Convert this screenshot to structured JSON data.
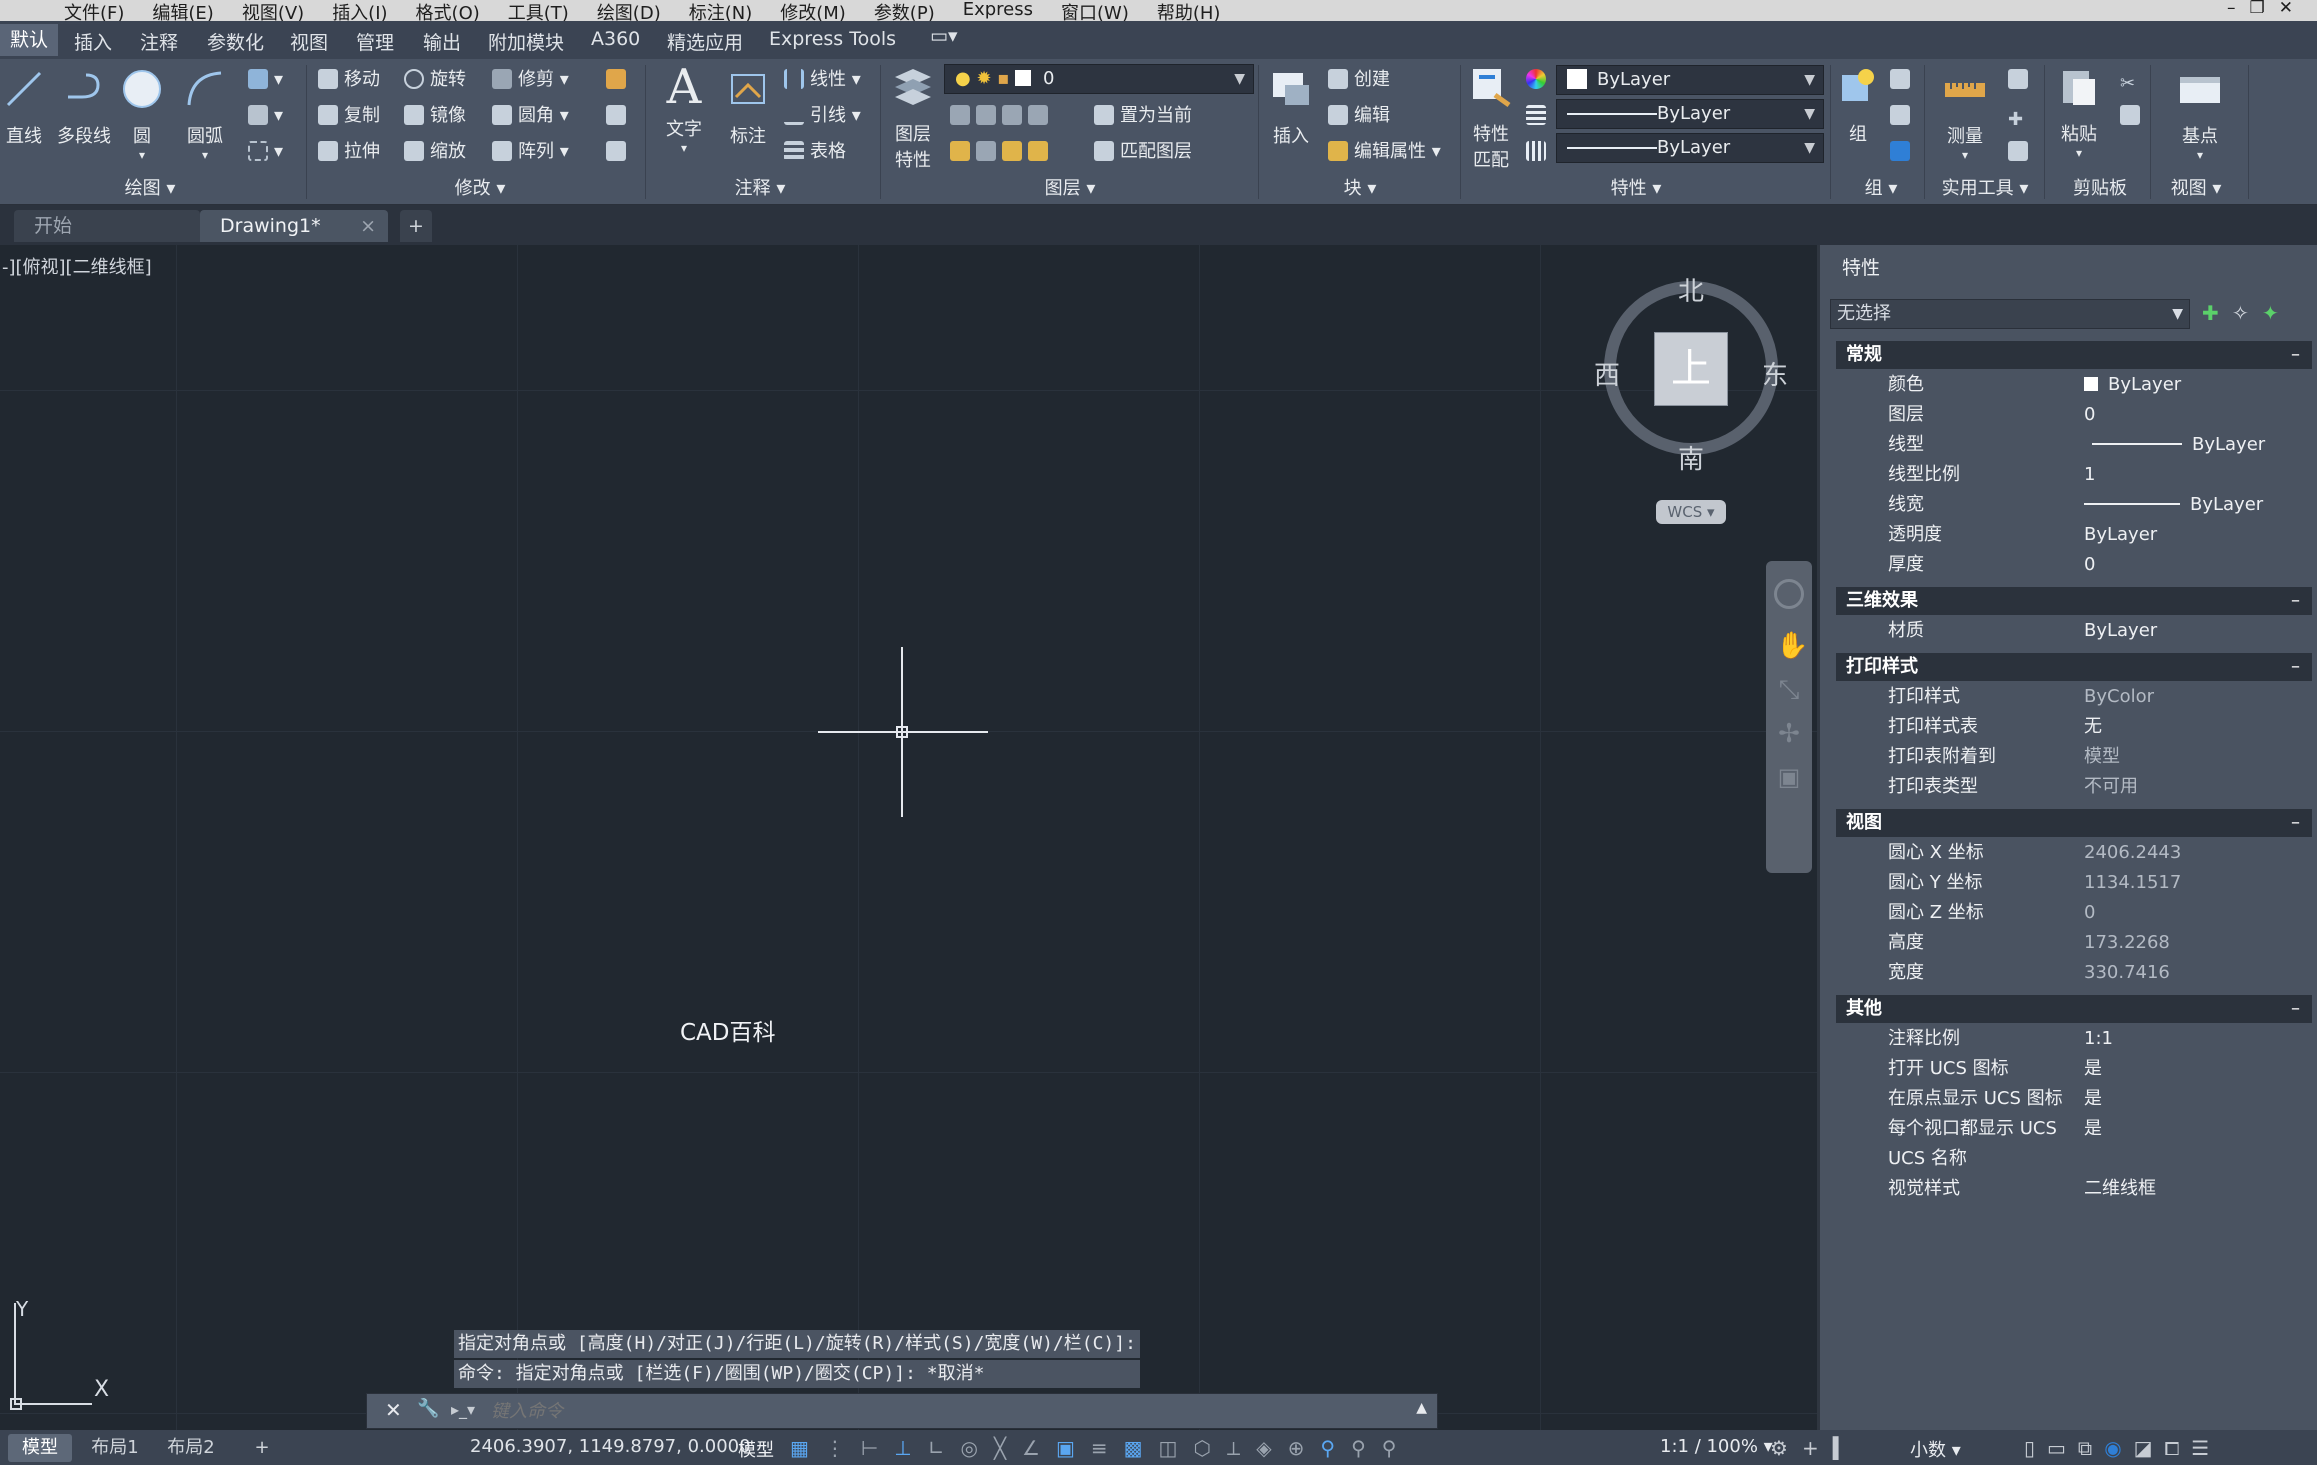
{
  "menubar": {
    "items": [
      "文件(F)",
      "编辑(E)",
      "视图(V)",
      "插入(I)",
      "格式(O)",
      "工具(T)",
      "绘图(D)",
      "标注(N)",
      "修改(M)",
      "参数(P)",
      "Express",
      "窗口(W)",
      "帮助(H)"
    ]
  },
  "ribbon_tabs": [
    "默认",
    "插入",
    "注释",
    "参数化",
    "视图",
    "管理",
    "输出",
    "附加模块",
    "A360",
    "精选应用",
    "Express Tools"
  ],
  "ribbon": {
    "draw": {
      "title": "绘图",
      "line": "直线",
      "polyline": "多段线",
      "circle": "圆",
      "arc": "圆弧"
    },
    "modify": {
      "title": "修改",
      "move": "移动",
      "rotate": "旋转",
      "trim": "修剪",
      "copy": "复制",
      "mirror": "镜像",
      "fillet": "圆角",
      "stretch": "拉伸",
      "scale": "缩放",
      "array": "阵列"
    },
    "annotation": {
      "title": "注释",
      "text": "文字",
      "dimension": "标注",
      "linear": "线性",
      "leader": "引线",
      "table": "表格"
    },
    "layers": {
      "title": "图层",
      "layer_props_l1": "图层",
      "layer_props_l2": "特性",
      "layer_value": "0",
      "set_current": "置为当前",
      "match_layer": "匹配图层"
    },
    "block": {
      "title": "块",
      "insert": "插入",
      "create": "创建",
      "edit": "编辑",
      "edit_attr": "编辑属性"
    },
    "properties": {
      "title": "特性",
      "match_l1": "特性",
      "match_l2": "匹配",
      "color": "ByLayer",
      "linetype": "ByLayer",
      "lineweight": "ByLayer"
    },
    "groups": {
      "title": "组",
      "group": "组"
    },
    "utilities": {
      "title": "实用工具",
      "measure": "测量"
    },
    "clipboard": {
      "title": "剪贴板",
      "paste": "粘贴"
    },
    "view": {
      "title": "视图",
      "base": "基点"
    }
  },
  "doc_tabs": {
    "start": "开始",
    "drawing": "Drawing1*",
    "close": "×",
    "add": "+"
  },
  "viewport": {
    "label": "-][俯视][二维线框]",
    "text_object": "CAD百科",
    "viewcube": {
      "north": "北",
      "south": "南",
      "east": "东",
      "west": "西",
      "face": "上",
      "wcs": "WCS"
    },
    "ucs": {
      "x": "X",
      "y": "Y"
    }
  },
  "command": {
    "history": [
      "指定对角点或 [高度(H)/对正(J)/行距(L)/旋转(R)/样式(S)/宽度(W)/栏(C)]:",
      "命令: 指定对角点或 [栏选(F)/圈围(WP)/圈交(CP)]: *取消*"
    ],
    "placeholder": "键入命令"
  },
  "properties_panel": {
    "title": "特性",
    "selection": "无选择",
    "sections": [
      {
        "name": "常规",
        "rows": [
          [
            "颜色",
            "ByLayer"
          ],
          [
            "图层",
            "0"
          ],
          [
            "线型",
            "ByLayer"
          ],
          [
            "线型比例",
            "1"
          ],
          [
            "线宽",
            "ByLayer"
          ],
          [
            "透明度",
            "ByLayer"
          ],
          [
            "厚度",
            "0"
          ]
        ]
      },
      {
        "name": "三维效果",
        "rows": [
          [
            "材质",
            "ByLayer"
          ]
        ]
      },
      {
        "name": "打印样式",
        "rows": [
          [
            "打印样式",
            "ByColor"
          ],
          [
            "打印样式表",
            "无"
          ],
          [
            "打印表附着到",
            "模型"
          ],
          [
            "打印表类型",
            "不可用"
          ]
        ]
      },
      {
        "name": "视图",
        "rows": [
          [
            "圆心 X 坐标",
            "2406.2443"
          ],
          [
            "圆心 Y 坐标",
            "1134.1517"
          ],
          [
            "圆心 Z 坐标",
            "0"
          ],
          [
            "高度",
            "173.2268"
          ],
          [
            "宽度",
            "330.7416"
          ]
        ]
      },
      {
        "name": "其他",
        "rows": [
          [
            "注释比例",
            "1:1"
          ],
          [
            "打开 UCS 图标",
            "是"
          ],
          [
            "在原点显示 UCS 图标",
            "是"
          ],
          [
            "每个视口都显示 UCS",
            "是"
          ],
          [
            "UCS 名称",
            ""
          ],
          [
            "视觉样式",
            "二维线框"
          ]
        ]
      }
    ]
  },
  "statusbar": {
    "layouts": [
      "模型",
      "布局1",
      "布局2"
    ],
    "add": "+",
    "coords": "2406.3907, 1149.8797, 0.0000",
    "space": "模型",
    "scale": "1:1 / 100%",
    "units": "小数"
  },
  "colors": {
    "background": "#212830",
    "ribbon": "#4a5464",
    "accent": "#2f7fd6"
  }
}
